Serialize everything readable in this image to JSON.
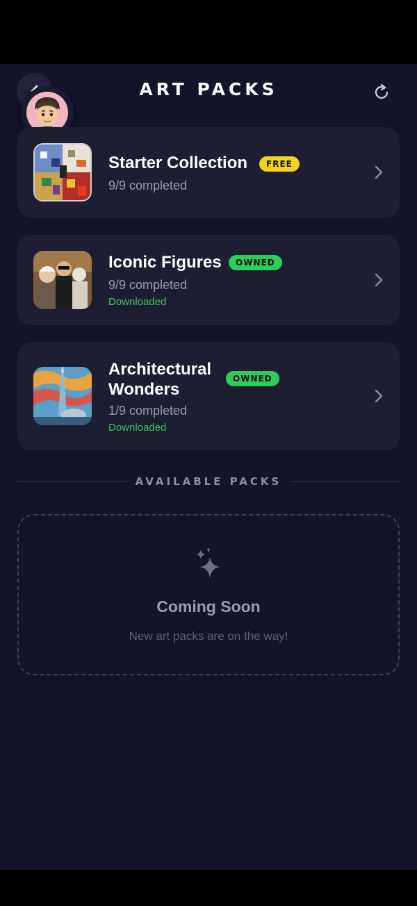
{
  "header": {
    "title": "ART PACKS",
    "back_icon": "chevron-left-icon",
    "refresh_icon": "refresh-icon"
  },
  "owned_packs": [
    {
      "name_line1": "Starter Collection",
      "name_line2": "",
      "badge": "FREE",
      "progress": "9/9 completed",
      "status": ""
    },
    {
      "name_line1": "Iconic Figures",
      "name_line2": "",
      "badge": "OWNED",
      "progress": "9/9 completed",
      "status": "Downloaded"
    },
    {
      "name_line1": "Architectural",
      "name_line2": "Wonders",
      "badge": "OWNED",
      "progress": "1/9 completed",
      "status": "Downloaded"
    }
  ],
  "available": {
    "section_title": "AVAILABLE PACKS",
    "coming_soon_title": "Coming Soon",
    "coming_soon_subtitle": "New art packs are on the way!",
    "icon": "sparkle-icon"
  },
  "colors": {
    "background": "#13132a",
    "card": "#1e1e33",
    "free_badge": "#f5d21c",
    "owned_badge": "#2ecc5a",
    "downloaded": "#34c759"
  }
}
